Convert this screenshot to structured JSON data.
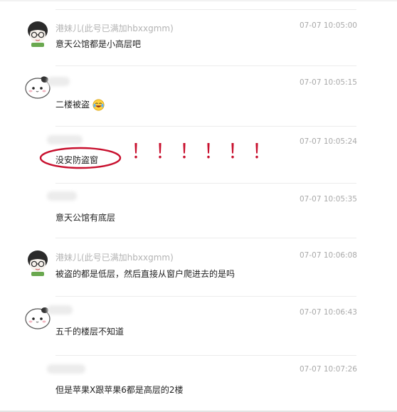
{
  "messages": [
    {
      "name": "港妹儿(此号已满加hbxxgmm)",
      "time": "07-07 10:05:00",
      "text": "意天公馆都是小高层吧"
    },
    {
      "name": "",
      "time": "07-07 10:05:15",
      "text": "二楼被盗"
    },
    {
      "name": "",
      "time": "07-07 10:05:24",
      "text": "没安防盗窗"
    },
    {
      "name": "",
      "time": "07-07 10:05:35",
      "text": "意天公馆有底层"
    },
    {
      "name": "港妹儿(此号已满加hbxxgmm)",
      "time": "07-07 10:06:08",
      "text": "被盗的都是低层，然后直接从窗户爬进去的是吗"
    },
    {
      "name": "",
      "time": "07-07 10:06:43",
      "text": "五千的楼层不知道"
    },
    {
      "name": "",
      "time": "07-07 10:07:26",
      "text": "但是苹果X跟苹果6都是高层的2楼"
    }
  ],
  "annotation": {
    "marks": "！！！！！！",
    "color": "#c8102e"
  },
  "icons": {
    "girl_avatar": "girl-with-glasses-avatar-icon",
    "cat_avatar": "white-cat-avatar-icon",
    "emoji": "laughing-crying-emoji-icon"
  }
}
